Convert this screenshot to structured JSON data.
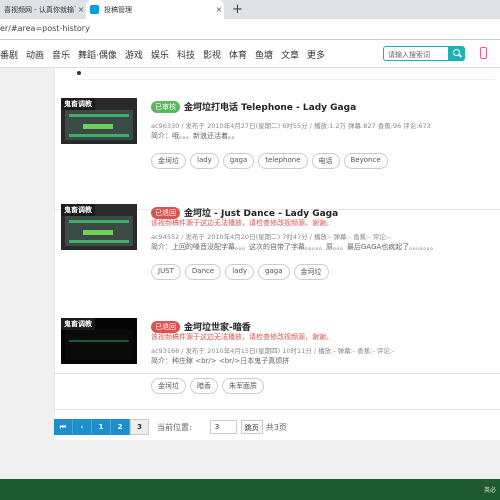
{
  "browser": {
    "tabs": [
      {
        "label": "喜视频网 - 认真你就输了"
      },
      {
        "label": "投稿管理"
      }
    ],
    "new_tab": "+",
    "close_glyph": "×",
    "url": "er/#area=post-history"
  },
  "nav": {
    "items": [
      "番剧",
      "动画",
      "音乐",
      "舞蹈·偶像",
      "游戏",
      "娱乐",
      "科技",
      "影视",
      "体育",
      "鱼塘",
      "文章",
      "更多"
    ],
    "search_placeholder": "请输入搜索词"
  },
  "items": [
    {
      "thumb_title": "鬼畜调教",
      "status": "已审核",
      "title": "金坷垃打电话 Telephone - Lady Gaga",
      "warning": "",
      "meta": "ac96330 / 发布于 2010年4月27日(星期二) 6时55分 / 播放:1.2万  弹幕:827  香蕉:96  评论:673",
      "desc": "简介：哦。。。新浪还活着。。",
      "tags": [
        "金坷垃",
        "lady",
        "gaga",
        "telephone",
        "电话",
        "Beyonce"
      ]
    },
    {
      "thumb_title": "鬼畜调教",
      "status": "已退回",
      "title": "金坷垃 - Just Dance - Lady Gaga",
      "warning": "该视频稿件源于这边无法播放，请检查修改视频源，谢谢。",
      "meta": "ac94552 / 发布于 2010年4月20日(星期二) 7时47分 / 播放:-  弹幕:-  香蕉:-  评论:-",
      "desc": "简介：上回的嗓音没配字幕。。。这次的自带了字幕。。。。。原。。。最后GAGA也疯起了。。。。。。。",
      "tags": [
        "JUST",
        "Dance",
        "lady",
        "gaga",
        "金坷垃"
      ]
    },
    {
      "thumb_title": "鬼畜调教",
      "status": "已退回",
      "title": "金坷垃世家-暗香",
      "warning": "该视频稿件源于这边无法播放，请检查修改视频源，谢谢。",
      "meta": "ac93166 / 发布于 2010年4月15日(星期四) 10时11分 / 播放:-  弹幕:-  香蕉:-  评论:-",
      "desc": "简介：种庄稼 <br/> <br/>日本鬼子真烦拼",
      "tags": [
        "金坷垃",
        "暗香",
        "朱军面质"
      ]
    }
  ],
  "pager": {
    "buttons": [
      "⏮",
      "‹",
      "1",
      "2",
      "3"
    ],
    "current_label": "当前位置:",
    "current_value": "3",
    "go": "跳页",
    "total": "共3页"
  },
  "taskbar": {
    "tray_text": "英必"
  },
  "colors": {
    "accent": "#1fb0b6",
    "pager_blue": "#1c8ecb",
    "approved": "#5cb85c",
    "rejected": "#d9534f",
    "taskbar": "#1d5a2e"
  }
}
